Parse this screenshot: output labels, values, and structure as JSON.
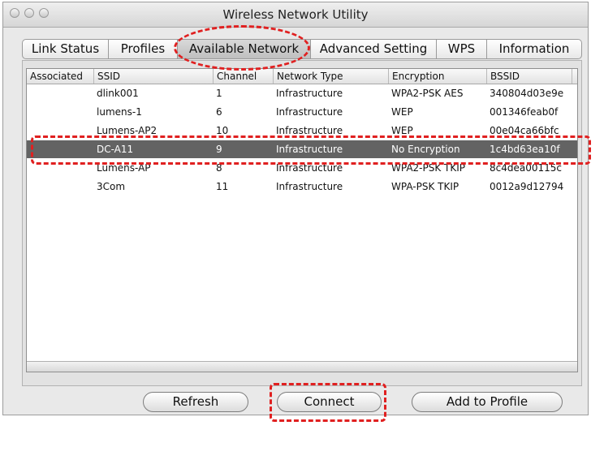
{
  "window": {
    "title": "Wireless Network Utility"
  },
  "tabs": [
    {
      "label": "Link Status"
    },
    {
      "label": "Profiles"
    },
    {
      "label": "Available Network"
    },
    {
      "label": "Advanced Setting"
    },
    {
      "label": "WPS"
    },
    {
      "label": "Information"
    }
  ],
  "table": {
    "headers": [
      "Associated",
      "SSID",
      "Channel",
      "Network Type",
      "Encryption",
      "BSSID"
    ],
    "rows": [
      {
        "associated": "",
        "ssid": "dlink001",
        "channel": "1",
        "type": "Infrastructure",
        "encryption": "WPA2-PSK AES",
        "bssid": "340804d03e9e"
      },
      {
        "associated": "",
        "ssid": "lumens-1",
        "channel": "6",
        "type": "Infrastructure",
        "encryption": "WEP",
        "bssid": "001346feab0f"
      },
      {
        "associated": "",
        "ssid": "Lumens-AP2",
        "channel": "10",
        "type": "Infrastructure",
        "encryption": "WEP",
        "bssid": "00e04ca66bfc"
      },
      {
        "associated": "",
        "ssid": "DC-A11",
        "channel": "9",
        "type": "Infrastructure",
        "encryption": "No Encryption",
        "bssid": "1c4bd63ea10f"
      },
      {
        "associated": "",
        "ssid": "Lumens-AP",
        "channel": "8",
        "type": "Infrastructure",
        "encryption": "WPA2-PSK TKIP",
        "bssid": "8c4dea00115c"
      },
      {
        "associated": "",
        "ssid": "3Com",
        "channel": "11",
        "type": "Infrastructure",
        "encryption": "WPA-PSK TKIP",
        "bssid": "0012a9d12794"
      }
    ]
  },
  "buttons": {
    "refresh": "Refresh",
    "connect": "Connect",
    "add_to_profile": "Add to Profile"
  },
  "colors": {
    "selection": "#636363",
    "annotation": "#e02020"
  }
}
